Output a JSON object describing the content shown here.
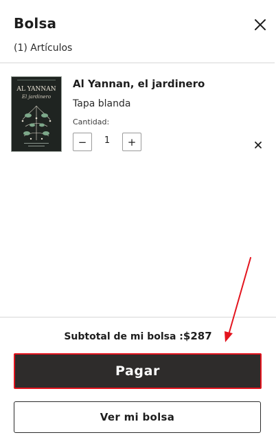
{
  "header": {
    "title": "Bolsa",
    "count": "(1) Artículos"
  },
  "cart": {
    "items": [
      {
        "cover": {
          "title_top": "AL YANNAN",
          "subtitle": "El jardinero"
        },
        "title": "Al Yannan, el jardinero",
        "format": "Tapa blanda",
        "quantity_label": "Cantidad:",
        "quantity": "1",
        "minus_label": "−",
        "plus_label": "+"
      }
    ]
  },
  "footer": {
    "subtotal_label": "Subtotal de mi bolsa :",
    "subtotal_amount": "$287",
    "pay_label": "Pagar",
    "view_label": "Ver mi bolsa"
  },
  "colors": {
    "primary_button": "#2e2c2b",
    "highlight": "#e3141e",
    "text": "#1d1d1d"
  }
}
